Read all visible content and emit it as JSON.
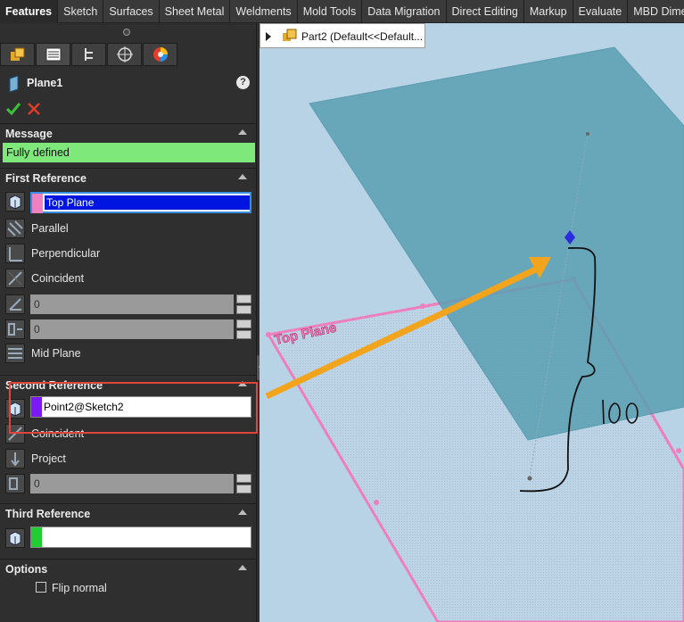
{
  "tabs": [
    {
      "label": "Features",
      "active": true
    },
    {
      "label": "Sketch"
    },
    {
      "label": "Surfaces"
    },
    {
      "label": "Sheet Metal"
    },
    {
      "label": "Weldments"
    },
    {
      "label": "Mold Tools"
    },
    {
      "label": "Data Migration"
    },
    {
      "label": "Direct Editing"
    },
    {
      "label": "Markup"
    },
    {
      "label": "Evaluate"
    },
    {
      "label": "MBD Dime"
    }
  ],
  "panel": {
    "icon_tabs": [
      "feature-manager-icon",
      "property-manager-icon",
      "configuration-manager-icon",
      "dimxpert-icon",
      "display-manager-icon"
    ],
    "title": "Plane1",
    "help": "?",
    "message_header": "Message",
    "message": "Fully defined",
    "first_ref": {
      "header": "First Reference",
      "value": "Top Plane",
      "swatch": "#f080c0",
      "options": [
        "Parallel",
        "Perpendicular",
        "Coincident"
      ],
      "angle_value": "0",
      "offset_value": "0",
      "mid_plane": "Mid Plane"
    },
    "second_ref": {
      "header": "Second Reference",
      "value": "Point2@Sketch2",
      "swatch": "#7a19ff",
      "options": [
        "Coincident",
        "Project"
      ],
      "value_field": "0"
    },
    "third_ref": {
      "header": "Third Reference",
      "value": "",
      "swatch": "#22cc33"
    },
    "options": {
      "header": "Options",
      "flip_normal": "Flip normal"
    }
  },
  "viewport": {
    "breadcrumb": "Part2  (Default<<Default...",
    "plane_label": "Top Plane",
    "handwriting": "100"
  },
  "colors": {
    "plane_fill": "#5aa0b3",
    "top_plane_edge": "#ee7fbd",
    "arrow": "#f2a41d",
    "annotation_box": "#e0443a",
    "message_bg": "#7ee87b"
  }
}
